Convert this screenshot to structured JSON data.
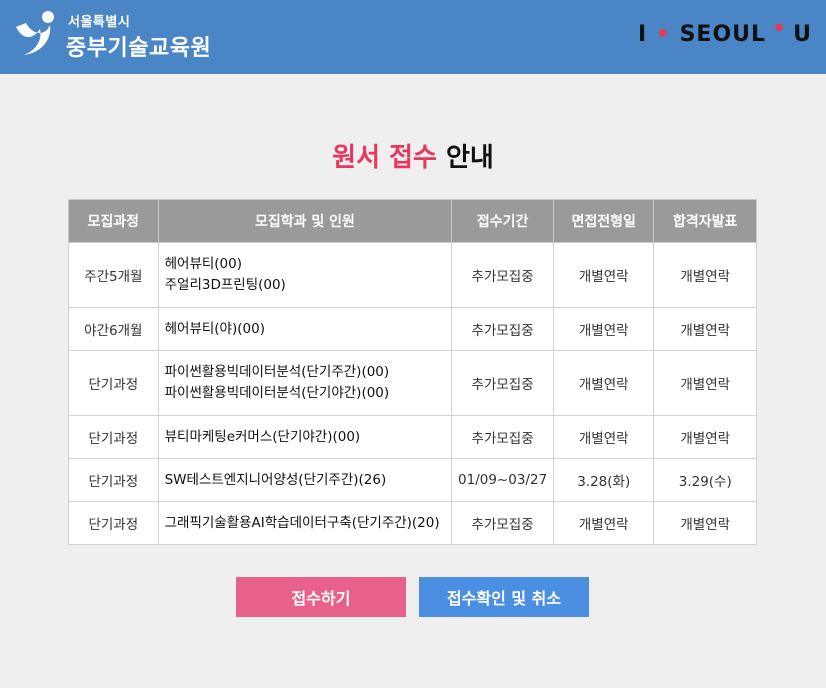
{
  "header": {
    "org_small": "서울특별시",
    "org_large": "중부기술교육원",
    "brand_left": "I",
    "brand_mid": "SEOUL",
    "brand_right": "U"
  },
  "title": {
    "accent": "원서 접수",
    "plain": "안내"
  },
  "table": {
    "headers": [
      "모집과정",
      "모집학과 및 인원",
      "접수기간",
      "면접전형일",
      "합격자발표"
    ],
    "rows": [
      {
        "course": "주간5개월",
        "depts": [
          "헤어뷰티(00)",
          "주얼리3D프린팅(00)"
        ],
        "period": "추가모집중",
        "interview": "개별연락",
        "result": "개별연락"
      },
      {
        "course": "야간6개월",
        "depts": [
          "헤어뷰티(야)(00)"
        ],
        "period": "추가모집중",
        "interview": "개별연락",
        "result": "개별연락"
      },
      {
        "course": "단기과정",
        "depts": [
          "파이썬활용빅데이터분석(단기주간)(00)",
          "파이썬활용빅데이터분석(단기야간)(00)"
        ],
        "period": "추가모집중",
        "interview": "개별연락",
        "result": "개별연락"
      },
      {
        "course": "단기과정",
        "depts": [
          "뷰티마케팅e커머스(단기야간)(00)"
        ],
        "period": "추가모집중",
        "interview": "개별연락",
        "result": "개별연락"
      },
      {
        "course": "단기과정",
        "depts": [
          "SW테스트엔지니어양성(단기주간)(26)"
        ],
        "period": "01/09~03/27",
        "interview": "3.28(화)",
        "result": "3.29(수)"
      },
      {
        "course": "단기과정",
        "depts": [
          "그래픽기술활용AI학습데이터구축(단기주간)(20)"
        ],
        "period": "추가모집중",
        "interview": "개별연락",
        "result": "개별연락"
      }
    ]
  },
  "buttons": {
    "apply": "접수하기",
    "check": "접수확인 및 취소"
  }
}
